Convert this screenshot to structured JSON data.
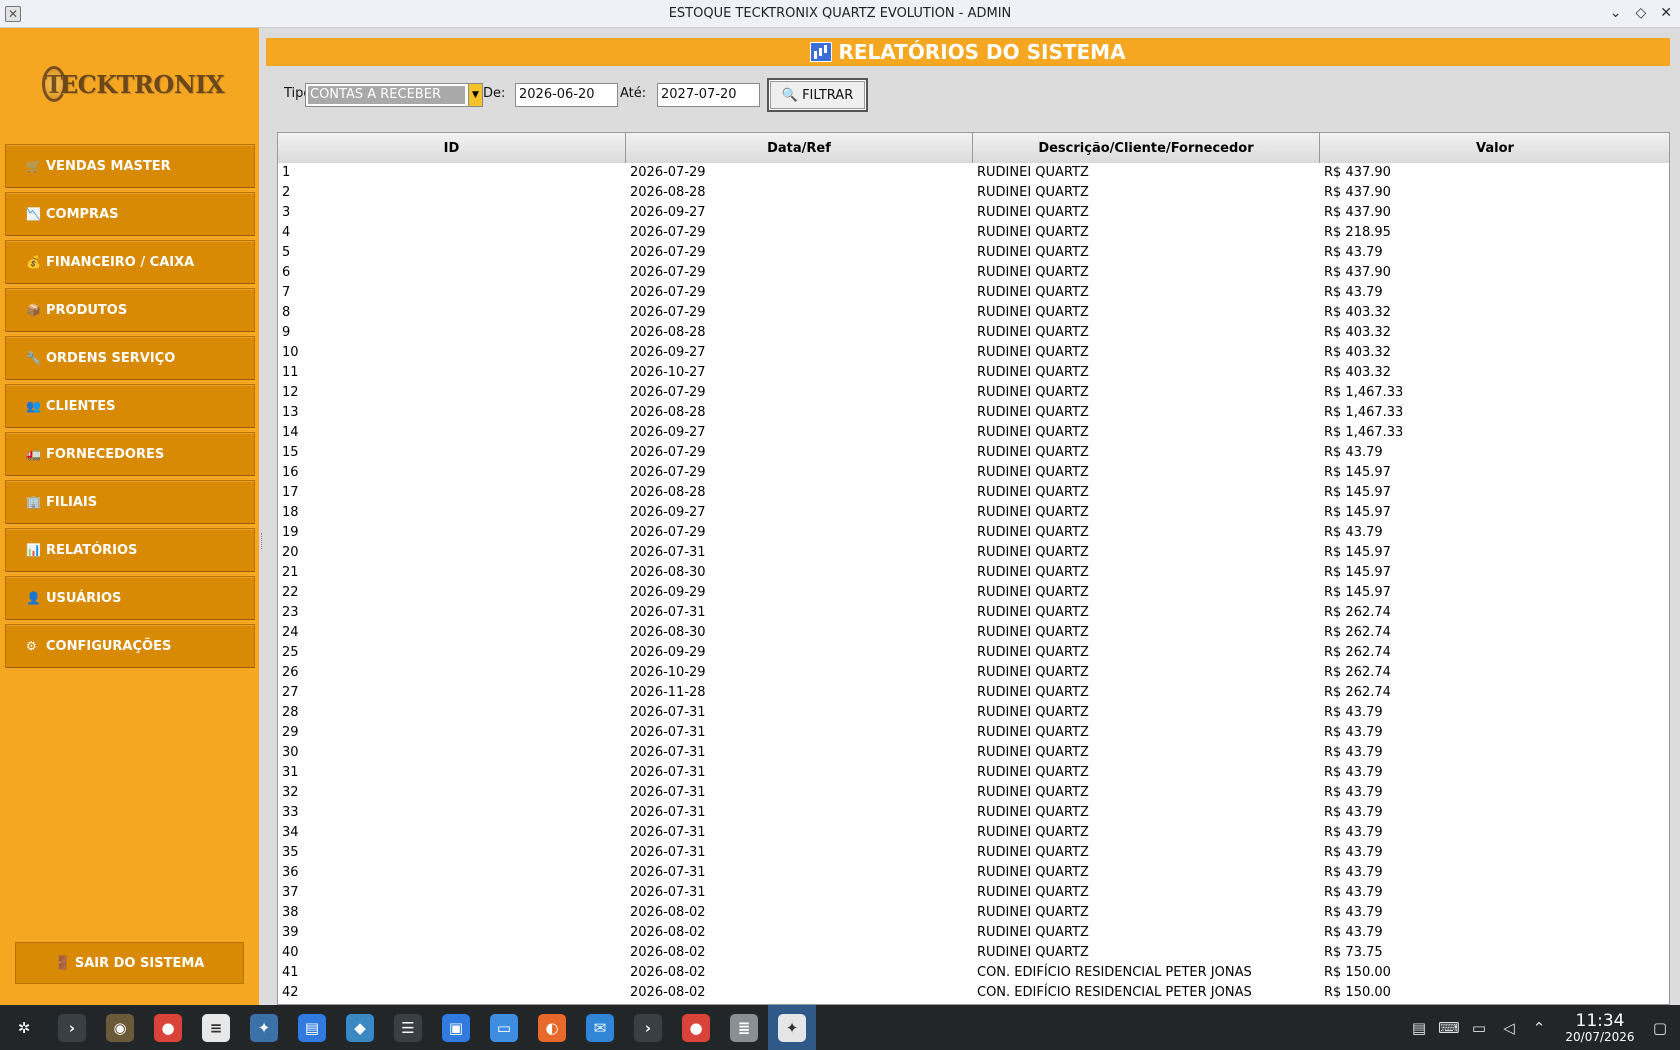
{
  "window": {
    "title": "ESTOQUE TECKTRONIX QUARTZ EVOLUTION - ADMIN"
  },
  "logo": {
    "letter": "T",
    "text": "ECKTRONIX"
  },
  "sidebar": {
    "items": [
      {
        "icon": "🛒",
        "label": "VENDAS MASTER"
      },
      {
        "icon": "📉",
        "label": "COMPRAS"
      },
      {
        "icon": "💰",
        "label": "FINANCEIRO / CAIXA"
      },
      {
        "icon": "📦",
        "label": "PRODUTOS"
      },
      {
        "icon": "🔧",
        "label": "ORDENS SERVIÇO"
      },
      {
        "icon": "👥",
        "label": "CLIENTES"
      },
      {
        "icon": "🚛",
        "label": "FORNECEDORES"
      },
      {
        "icon": "🏢",
        "label": "FILIAIS"
      },
      {
        "icon": "📊",
        "label": "RELATÓRIOS"
      },
      {
        "icon": "👤",
        "label": "USUÁRIOS"
      },
      {
        "icon": "⚙",
        "label": "CONFIGURAÇÕES"
      }
    ],
    "exit": {
      "icon": "🚪",
      "label": "SAIR DO SISTEMA"
    }
  },
  "header": {
    "title": "RELATÓRIOS DO SISTEMA"
  },
  "filters": {
    "tipo_label": "Tipo:",
    "tipo_value": "CONTAS A RECEBER",
    "de_label": "De:",
    "de_value": "2026-06-20",
    "ate_label": "Até:",
    "ate_value": "2027-07-20",
    "button_label": "🔍 FILTRAR"
  },
  "table": {
    "columns": [
      "ID",
      "Data/Ref",
      "Descrição/Cliente/Fornecedor",
      "Valor"
    ],
    "rows": [
      [
        "1",
        "2026-07-29",
        "RUDINEI QUARTZ",
        "R$ 437.90"
      ],
      [
        "2",
        "2026-08-28",
        "RUDINEI QUARTZ",
        "R$ 437.90"
      ],
      [
        "3",
        "2026-09-27",
        "RUDINEI QUARTZ",
        "R$ 437.90"
      ],
      [
        "4",
        "2026-07-29",
        "RUDINEI QUARTZ",
        "R$ 218.95"
      ],
      [
        "5",
        "2026-07-29",
        "RUDINEI QUARTZ",
        "R$ 43.79"
      ],
      [
        "6",
        "2026-07-29",
        "RUDINEI QUARTZ",
        "R$ 437.90"
      ],
      [
        "7",
        "2026-07-29",
        "RUDINEI QUARTZ",
        "R$ 43.79"
      ],
      [
        "8",
        "2026-07-29",
        "RUDINEI QUARTZ",
        "R$ 403.32"
      ],
      [
        "9",
        "2026-08-28",
        "RUDINEI QUARTZ",
        "R$ 403.32"
      ],
      [
        "10",
        "2026-09-27",
        "RUDINEI QUARTZ",
        "R$ 403.32"
      ],
      [
        "11",
        "2026-10-27",
        "RUDINEI QUARTZ",
        "R$ 403.32"
      ],
      [
        "12",
        "2026-07-29",
        "RUDINEI QUARTZ",
        "R$ 1,467.33"
      ],
      [
        "13",
        "2026-08-28",
        "RUDINEI QUARTZ",
        "R$ 1,467.33"
      ],
      [
        "14",
        "2026-09-27",
        "RUDINEI QUARTZ",
        "R$ 1,467.33"
      ],
      [
        "15",
        "2026-07-29",
        "RUDINEI QUARTZ",
        "R$ 43.79"
      ],
      [
        "16",
        "2026-07-29",
        "RUDINEI QUARTZ",
        "R$ 145.97"
      ],
      [
        "17",
        "2026-08-28",
        "RUDINEI QUARTZ",
        "R$ 145.97"
      ],
      [
        "18",
        "2026-09-27",
        "RUDINEI QUARTZ",
        "R$ 145.97"
      ],
      [
        "19",
        "2026-07-29",
        "RUDINEI QUARTZ",
        "R$ 43.79"
      ],
      [
        "20",
        "2026-07-31",
        "RUDINEI QUARTZ",
        "R$ 145.97"
      ],
      [
        "21",
        "2026-08-30",
        "RUDINEI QUARTZ",
        "R$ 145.97"
      ],
      [
        "22",
        "2026-09-29",
        "RUDINEI QUARTZ",
        "R$ 145.97"
      ],
      [
        "23",
        "2026-07-31",
        "RUDINEI QUARTZ",
        "R$ 262.74"
      ],
      [
        "24",
        "2026-08-30",
        "RUDINEI QUARTZ",
        "R$ 262.74"
      ],
      [
        "25",
        "2026-09-29",
        "RUDINEI QUARTZ",
        "R$ 262.74"
      ],
      [
        "26",
        "2026-10-29",
        "RUDINEI QUARTZ",
        "R$ 262.74"
      ],
      [
        "27",
        "2026-11-28",
        "RUDINEI QUARTZ",
        "R$ 262.74"
      ],
      [
        "28",
        "2026-07-31",
        "RUDINEI QUARTZ",
        "R$ 43.79"
      ],
      [
        "29",
        "2026-07-31",
        "RUDINEI QUARTZ",
        "R$ 43.79"
      ],
      [
        "30",
        "2026-07-31",
        "RUDINEI QUARTZ",
        "R$ 43.79"
      ],
      [
        "31",
        "2026-07-31",
        "RUDINEI QUARTZ",
        "R$ 43.79"
      ],
      [
        "32",
        "2026-07-31",
        "RUDINEI QUARTZ",
        "R$ 43.79"
      ],
      [
        "33",
        "2026-07-31",
        "RUDINEI QUARTZ",
        "R$ 43.79"
      ],
      [
        "34",
        "2026-07-31",
        "RUDINEI QUARTZ",
        "R$ 43.79"
      ],
      [
        "35",
        "2026-07-31",
        "RUDINEI QUARTZ",
        "R$ 43.79"
      ],
      [
        "36",
        "2026-07-31",
        "RUDINEI QUARTZ",
        "R$ 43.79"
      ],
      [
        "37",
        "2026-07-31",
        "RUDINEI QUARTZ",
        "R$ 43.79"
      ],
      [
        "38",
        "2026-08-02",
        "RUDINEI QUARTZ",
        "R$ 43.79"
      ],
      [
        "39",
        "2026-08-02",
        "RUDINEI QUARTZ",
        "R$ 43.79"
      ],
      [
        "40",
        "2026-08-02",
        "RUDINEI QUARTZ",
        "R$ 73.75"
      ],
      [
        "41",
        "2026-08-02",
        "CON. EDIFÍCIO RESIDENCIAL PETER JONAS",
        "R$ 150.00"
      ],
      [
        "42",
        "2026-08-02",
        "CON. EDIFÍCIO RESIDENCIAL PETER JONAS",
        "R$ 150.00"
      ]
    ]
  },
  "taskbar": {
    "apps": [
      {
        "icon": "app-launcher-icon",
        "glyph": "✲",
        "color": "#232629"
      },
      {
        "icon": "terminal-icon",
        "glyph": "›",
        "color": "#3a3f44"
      },
      {
        "icon": "gimp-icon",
        "glyph": "◉",
        "color": "#6b5a3a"
      },
      {
        "icon": "chrome-icon",
        "glyph": "●",
        "color": "#d9433a"
      },
      {
        "icon": "text-editor-icon",
        "glyph": "≡",
        "color": "#e8e8e8"
      },
      {
        "icon": "python-icon",
        "glyph": "✦",
        "color": "#3a72a8"
      },
      {
        "icon": "document-icon",
        "glyph": "▤",
        "color": "#2f7be0"
      },
      {
        "icon": "fish-icon",
        "glyph": "◆",
        "color": "#3a88c4"
      },
      {
        "icon": "settings-sliders-icon",
        "glyph": "☰",
        "color": "#3a3f44"
      },
      {
        "icon": "store-icon",
        "glyph": "▣",
        "color": "#2f7be0"
      },
      {
        "icon": "file-manager-icon",
        "glyph": "▭",
        "color": "#3d8ee0"
      },
      {
        "icon": "firefox-icon",
        "glyph": "◐",
        "color": "#e8692a"
      },
      {
        "icon": "thunderbird-icon",
        "glyph": "✉",
        "color": "#2f86d6"
      },
      {
        "icon": "terminal-icon",
        "glyph": "›",
        "color": "#3a3f44"
      },
      {
        "icon": "chrome-icon",
        "glyph": "●",
        "color": "#d9433a"
      },
      {
        "icon": "database-icon",
        "glyph": "≣",
        "color": "#8a8f94"
      },
      {
        "icon": "python-app-icon",
        "glyph": "✦",
        "color": "#e6e6e6"
      }
    ],
    "tray": [
      "clipboard-icon",
      "keyboard-icon",
      "network-icon",
      "volume-icon",
      "tray-expand-icon"
    ],
    "time": "11:34",
    "date": "20/07/2026"
  },
  "colors": {
    "accent": "#f5a722",
    "button": "#d98a05",
    "taskbar": "#232629"
  }
}
